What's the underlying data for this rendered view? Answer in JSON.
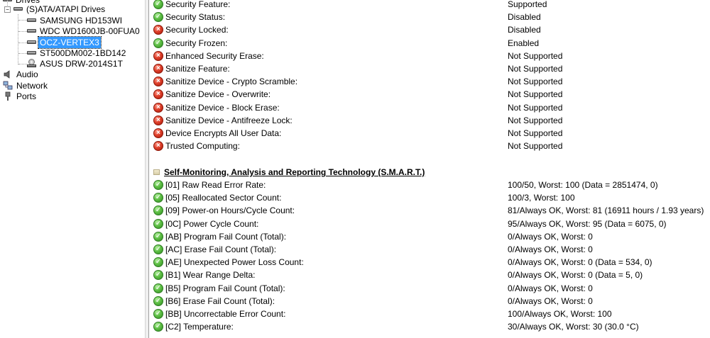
{
  "tree": {
    "top_partial_label": "Drives",
    "group_label": "(S)ATA/ATAPI Drives",
    "drives": [
      {
        "label": "SAMSUNG HD153WI",
        "kind": "hdd-icon",
        "selected": false
      },
      {
        "label": "WDC WD1600JB-00FUA0",
        "kind": "hdd-icon",
        "selected": false
      },
      {
        "label": "OCZ-VERTEX3",
        "kind": "hdd-icon",
        "selected": true
      },
      {
        "label": "ST500DM002-1BD142",
        "kind": "hdd-icon",
        "selected": false
      },
      {
        "label": "ASUS DRW-2014S1T",
        "kind": "cdrom-icon",
        "selected": false
      }
    ],
    "categories": [
      {
        "label": "Audio",
        "icon": "speaker-icon"
      },
      {
        "label": "Network",
        "icon": "network-icon"
      },
      {
        "label": "Ports",
        "icon": "port-icon"
      }
    ]
  },
  "security": {
    "rows": [
      {
        "field": "Security Feature:",
        "value": "Supported",
        "status": "ok"
      },
      {
        "field": "Security Status:",
        "value": "Disabled",
        "status": "ok"
      },
      {
        "field": "Security Locked:",
        "value": "Disabled",
        "status": "bad"
      },
      {
        "field": "Security Frozen:",
        "value": "Enabled",
        "status": "ok"
      },
      {
        "field": "Enhanced Security Erase:",
        "value": "Not Supported",
        "status": "bad"
      },
      {
        "field": "Sanitize Feature:",
        "value": "Not Supported",
        "status": "bad"
      },
      {
        "field": "Sanitize Device - Crypto Scramble:",
        "value": "Not Supported",
        "status": "bad"
      },
      {
        "field": "Sanitize Device - Overwrite:",
        "value": "Not Supported",
        "status": "bad"
      },
      {
        "field": "Sanitize Device - Block Erase:",
        "value": "Not Supported",
        "status": "bad"
      },
      {
        "field": "Sanitize Device - Antifreeze Lock:",
        "value": "Not Supported",
        "status": "bad"
      },
      {
        "field": "Device Encrypts All User Data:",
        "value": "Not Supported",
        "status": "bad"
      },
      {
        "field": "Trusted Computing:",
        "value": "Not Supported",
        "status": "bad"
      }
    ]
  },
  "smart": {
    "title": "Self-Monitoring, Analysis and Reporting Technology (S.M.A.R.T.)",
    "rows": [
      {
        "field": "[01] Raw Read Error Rate:",
        "value": "100/50, Worst: 100 (Data = 2851474, 0)",
        "status": "ok"
      },
      {
        "field": "[05] Reallocated Sector Count:",
        "value": "100/3, Worst: 100",
        "status": "ok"
      },
      {
        "field": "[09] Power-on Hours/Cycle Count:",
        "value": "81/Always OK, Worst: 81 (16911 hours / 1.93 years)",
        "status": "ok"
      },
      {
        "field": "[0C] Power Cycle Count:",
        "value": "95/Always OK, Worst: 95 (Data = 6075, 0)",
        "status": "ok"
      },
      {
        "field": "[AB] Program Fail Count (Total):",
        "value": "0/Always OK, Worst: 0",
        "status": "ok"
      },
      {
        "field": "[AC] Erase Fail Count (Total):",
        "value": "0/Always OK, Worst: 0",
        "status": "ok"
      },
      {
        "field": "[AE] Unexpected Power Loss Count:",
        "value": "0/Always OK, Worst: 0 (Data = 534, 0)",
        "status": "ok"
      },
      {
        "field": "[B1] Wear Range Delta:",
        "value": "0/Always OK, Worst: 0 (Data = 5, 0)",
        "status": "ok"
      },
      {
        "field": "[B5] Program Fail Count (Total):",
        "value": "0/Always OK, Worst: 0",
        "status": "ok"
      },
      {
        "field": "[B6] Erase Fail Count (Total):",
        "value": "0/Always OK, Worst: 0",
        "status": "ok"
      },
      {
        "field": "[BB] Uncorrectable Error Count:",
        "value": "100/Always OK, Worst: 100",
        "status": "ok"
      },
      {
        "field": "[C2] Temperature:",
        "value": "30/Always OK, Worst: 30 (30.0 °C)",
        "status": "ok"
      }
    ]
  },
  "colors": {
    "selection": "#3399ff",
    "ok": "#3ea52b",
    "bad": "#d5321c"
  }
}
